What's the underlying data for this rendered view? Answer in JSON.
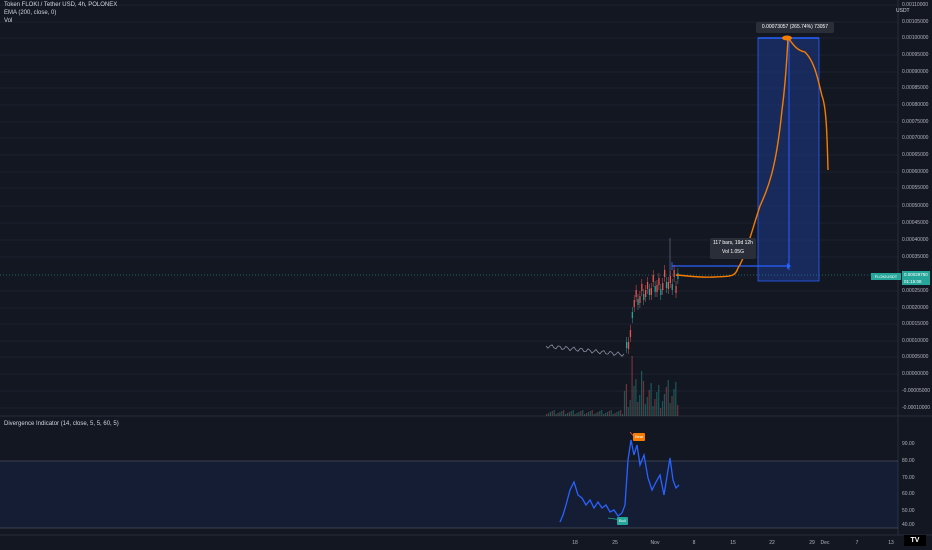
{
  "header": {
    "symbol_line": "Token FLOKI / Tether USD, 4h, POLONEX",
    "ema_line": "EMA (200, close, 0)",
    "vol_line": "Vol"
  },
  "price_axis": {
    "unit": "USDT",
    "ticks": [
      "0.00110000",
      "0.00105000",
      "0.00100000",
      "0.00095000",
      "0.00090000",
      "0.00085000",
      "0.00080000",
      "0.00075000",
      "0.00070000",
      "0.00065000",
      "0.00060000",
      "0.00055000",
      "0.00050000",
      "0.00045000",
      "0.00040000",
      "0.00035000",
      "0.00025000",
      "0.00020000",
      "0.00015000",
      "0.00010000",
      "0.00005000",
      "0.00000000",
      "-0.00005000",
      "-0.00010000"
    ],
    "symbol_tag": "FLOKIUSDT",
    "current_price": "0.00029750",
    "countdown": "01:16:08"
  },
  "oscillator": {
    "legend": "Divergence Indicator (14, close, 5, 5, 60, 5)",
    "ticks": [
      "90.00",
      "80.00",
      "70.00",
      "60.00",
      "50.00",
      "40.00",
      "30.00"
    ],
    "bear_label": "Bear",
    "bull_label": "Bull"
  },
  "time_axis": {
    "ticks": [
      "18",
      "25",
      "Nov",
      "8",
      "15",
      "22",
      "29",
      "Dec",
      "7",
      "13"
    ]
  },
  "annotations": {
    "target_label": "0.00073057 (265.74%) 73057",
    "range_line1": "117 bars, 19d 12h",
    "range_line2": "Vol 1.05G"
  },
  "logo": "TV",
  "colors": {
    "background": "#131722",
    "up": "#26a69a",
    "down": "#ef5350",
    "projection": "#f57c00",
    "measure_box": "#1e3a8a",
    "oscillator_line": "#2962ff"
  }
}
